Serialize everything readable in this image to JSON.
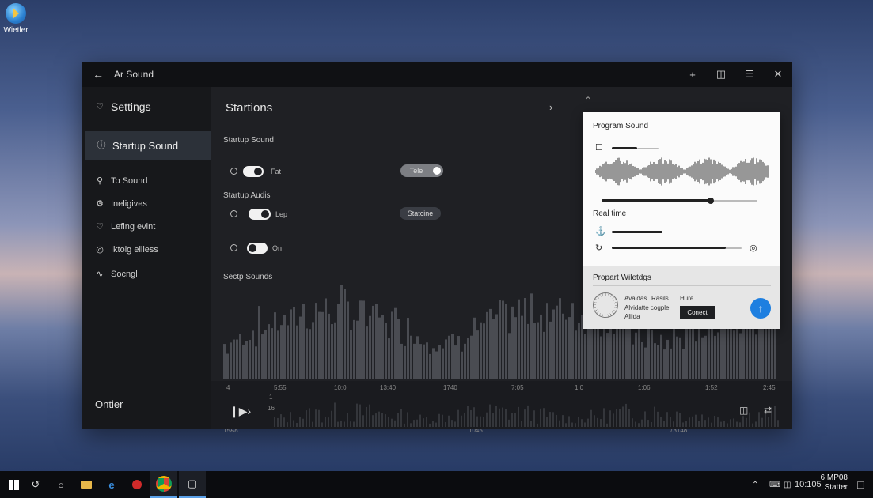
{
  "desktop": {
    "icon_label": "Wietler"
  },
  "window": {
    "title": "Ar Sound"
  },
  "sidebar": {
    "header": "Settings",
    "active": "Startup Sound",
    "items": [
      {
        "label": "To Sound",
        "icon": "search-icon"
      },
      {
        "label": "Ineligives",
        "icon": "gear-icon"
      },
      {
        "label": "Lefing evint",
        "icon": "heart-icon"
      },
      {
        "label": "Iktoig eilless",
        "icon": "circle-icon"
      },
      {
        "label": "Socngl",
        "icon": "wave-icon"
      }
    ],
    "footer": "Ontier"
  },
  "main": {
    "heading": "Startions",
    "section1": "Startup Sound",
    "row1": {
      "toggle_label": "Fat",
      "pill": "Tele"
    },
    "section2": "Startup Audis",
    "row2": {
      "toggle_label": "Lep",
      "pill": "Statcine"
    },
    "row3": {
      "toggle_label": "On"
    },
    "section3": "Sectp Sounds",
    "ticks_a": [
      "15A8",
      "1045",
      "73148"
    ],
    "ticks_b": [
      "4",
      "5:55",
      "10:0",
      "13:40",
      "1740",
      "7:05",
      "1:0",
      "1:06",
      "1:52",
      "2:45"
    ],
    "ticks_c": [
      "1",
      "16"
    ]
  },
  "card": {
    "program_sound": "Program Sound",
    "real_time": "Real time",
    "program_widgets": "Propart Wiletdgs",
    "info1": "Avaidas",
    "info2": "Rasils",
    "info3": "Alvidatte cogple",
    "info4": "Aliida",
    "info5": "Hure",
    "connect": "Conect",
    "slider1_level": 0.7,
    "slider2_level": 0.88
  },
  "taskbar": {
    "time": "10:105",
    "date_top": "6 MP08",
    "date_bottom": "Statter"
  }
}
